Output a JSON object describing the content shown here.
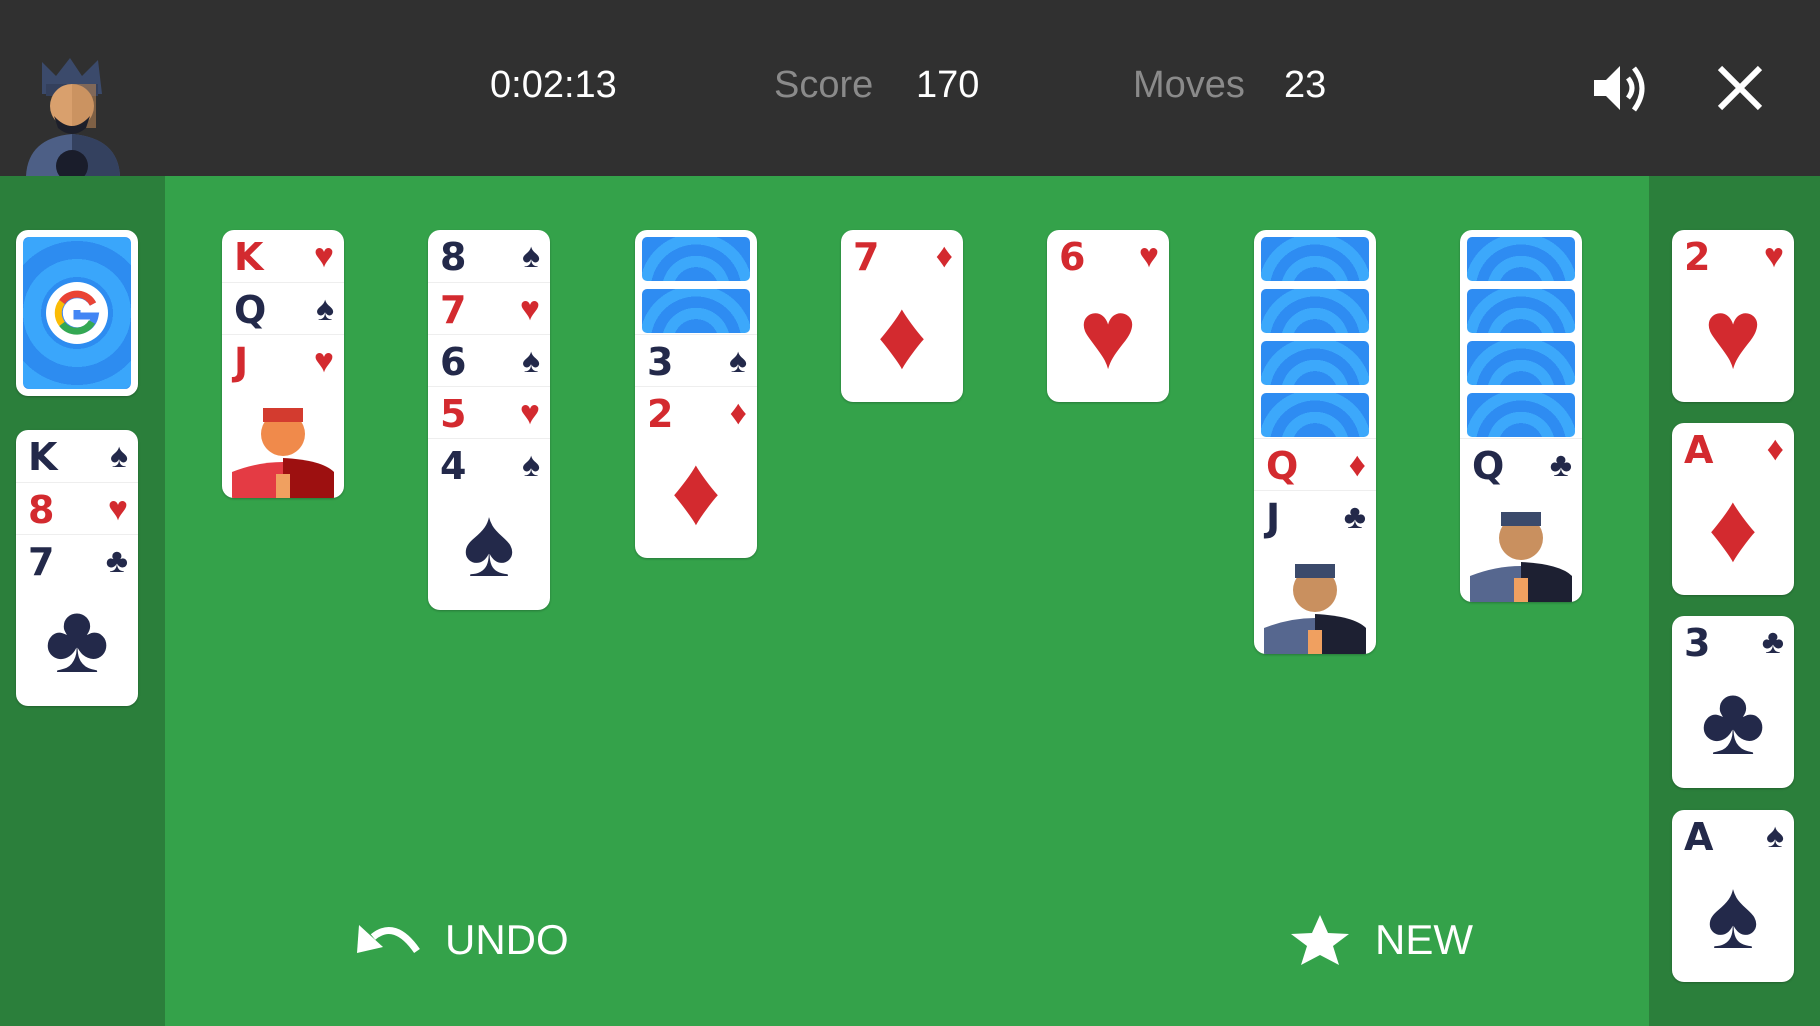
{
  "header": {
    "timer": "0:02:13",
    "score_label": "Score",
    "score_value": "170",
    "moves_label": "Moves",
    "moves_value": "23",
    "avatar_icon": "king-avatar-icon",
    "sound_icon": "speaker-icon",
    "close_icon": "close-icon"
  },
  "colors": {
    "header_bg": "#303030",
    "table_green": "#34a24a",
    "side_green": "#2b7f3b",
    "card_red": "#d32a2f",
    "card_black": "#23294a",
    "card_back_blue": "#3aa6fb"
  },
  "stock": {
    "face_down": true,
    "logo": "G"
  },
  "waste": [
    {
      "rank": "K",
      "suit": "♠",
      "color": "black"
    },
    {
      "rank": "8",
      "suit": "♥",
      "color": "red"
    },
    {
      "rank": "7",
      "suit": "♣",
      "color": "black"
    }
  ],
  "tableau": [
    {
      "hidden": 0,
      "cards": [
        {
          "rank": "K",
          "suit": "♥",
          "color": "red"
        },
        {
          "rank": "Q",
          "suit": "♠",
          "color": "black"
        },
        {
          "rank": "J",
          "suit": "♥",
          "color": "red"
        }
      ]
    },
    {
      "hidden": 0,
      "cards": [
        {
          "rank": "8",
          "suit": "♠",
          "color": "black"
        },
        {
          "rank": "7",
          "suit": "♥",
          "color": "red"
        },
        {
          "rank": "6",
          "suit": "♠",
          "color": "black"
        },
        {
          "rank": "5",
          "suit": "♥",
          "color": "red"
        },
        {
          "rank": "4",
          "suit": "♠",
          "color": "black"
        }
      ]
    },
    {
      "hidden": 2,
      "cards": [
        {
          "rank": "3",
          "suit": "♠",
          "color": "black"
        },
        {
          "rank": "2",
          "suit": "♦",
          "color": "red"
        }
      ]
    },
    {
      "hidden": 0,
      "cards": [
        {
          "rank": "7",
          "suit": "♦",
          "color": "red"
        }
      ]
    },
    {
      "hidden": 0,
      "cards": [
        {
          "rank": "6",
          "suit": "♥",
          "color": "red"
        }
      ]
    },
    {
      "hidden": 4,
      "cards": [
        {
          "rank": "Q",
          "suit": "♦",
          "color": "red"
        },
        {
          "rank": "J",
          "suit": "♣",
          "color": "black"
        }
      ]
    },
    {
      "hidden": 4,
      "cards": [
        {
          "rank": "Q",
          "suit": "♣",
          "color": "black"
        }
      ]
    }
  ],
  "foundations": [
    {
      "rank": "2",
      "suit": "♥",
      "color": "red"
    },
    {
      "rank": "A",
      "suit": "♦",
      "color": "red"
    },
    {
      "rank": "3",
      "suit": "♣",
      "color": "black"
    },
    {
      "rank": "A",
      "suit": "♠",
      "color": "black"
    }
  ],
  "actions": {
    "undo_label": "UNDO",
    "new_label": "NEW"
  }
}
